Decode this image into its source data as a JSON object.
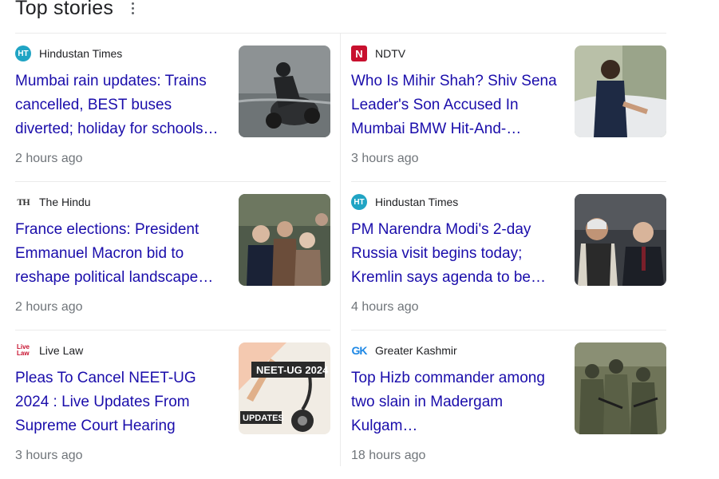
{
  "section": {
    "title": "Top stories"
  },
  "stories": [
    {
      "source": "Hindustan Times",
      "headline": "Mumbai rain updates: Trains cancelled, BEST buses diverted; holiday for schools…",
      "time": "2 hours ago",
      "icon": "hindustan-times-logo"
    },
    {
      "source": "NDTV",
      "headline": "Who Is Mihir Shah? Shiv Sena Leader's Son Accused In Mumbai BMW Hit-And-…",
      "time": "3 hours ago",
      "icon": "ndtv-logo"
    },
    {
      "source": "The Hindu",
      "headline": "France elections: President Emmanuel Macron bid to reshape political landscape…",
      "time": "2 hours ago",
      "icon": "the-hindu-logo"
    },
    {
      "source": "Hindustan Times",
      "headline": "PM Narendra Modi's 2-day Russia visit begins today; Kremlin says agenda to be…",
      "time": "4 hours ago",
      "icon": "hindustan-times-logo"
    },
    {
      "source": "Live Law",
      "headline": "Pleas To Cancel NEET-UG 2024 : Live Updates From Supreme Court Hearing",
      "time": "3 hours ago",
      "icon": "live-law-logo"
    },
    {
      "source": "Greater Kashmir",
      "headline": "Top Hizb commander among two slain in Madergam Kulgam…",
      "time": "18 hours ago",
      "icon": "greater-kashmir-logo"
    }
  ],
  "thumbnail_text": {
    "neet_label": "NEET-UG 2024",
    "updates_label": "UPDATES"
  },
  "logo_text": {
    "ht": "HT",
    "ndtv": "N",
    "hindu": "TH",
    "livelaw": "Live\nLaw",
    "gk": "GK"
  },
  "colors": {
    "link": "#1a0dab",
    "meta": "#70757a",
    "divider": "#ebebeb",
    "ht_brand": "#20a4c4",
    "ndtv_brand": "#c8102e",
    "gk_brand": "#1e88e5"
  }
}
